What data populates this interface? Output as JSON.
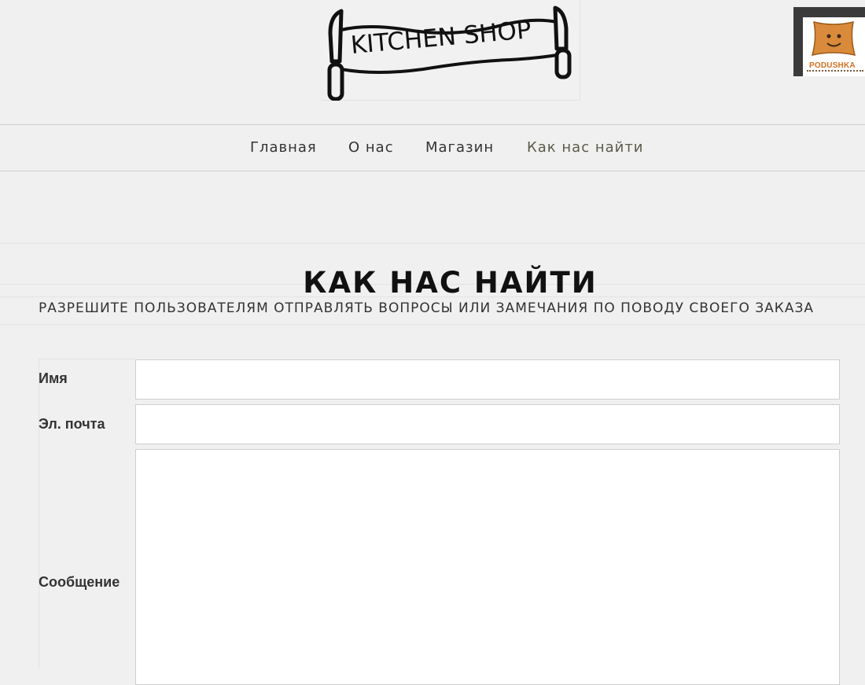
{
  "header": {
    "logo_text": "KITCHEN SHOP",
    "partner_badge_text": "PODUSHKA"
  },
  "nav": {
    "items": [
      {
        "label": "Главная"
      },
      {
        "label": "О нас"
      },
      {
        "label": "Магазин"
      },
      {
        "label": "Как нас найти"
      }
    ],
    "active_index": 3
  },
  "page": {
    "title": "КАК НАС НАЙТИ",
    "subtitle": "РАЗРЕШИТЕ ПОЛЬЗОВАТЕЛЯМ ОТПРАВЛЯТЬ ВОПРОСЫ ИЛИ ЗАМЕЧАНИЯ ПО ПОВОДУ СВОЕГО ЗАКАЗА"
  },
  "form": {
    "fields": [
      {
        "label": "Имя",
        "value": ""
      },
      {
        "label": "Эл. почта",
        "value": ""
      },
      {
        "label": "Сообщение",
        "value": ""
      }
    ]
  },
  "colors": {
    "background": "#f0f0f0",
    "accent_dash": "#b8a88e",
    "active_nav": "#5b5a4a",
    "partner_brand": "#d4701f"
  },
  "icons": {
    "logo": "knife-banner-logo",
    "partner": "pillow-logo"
  }
}
